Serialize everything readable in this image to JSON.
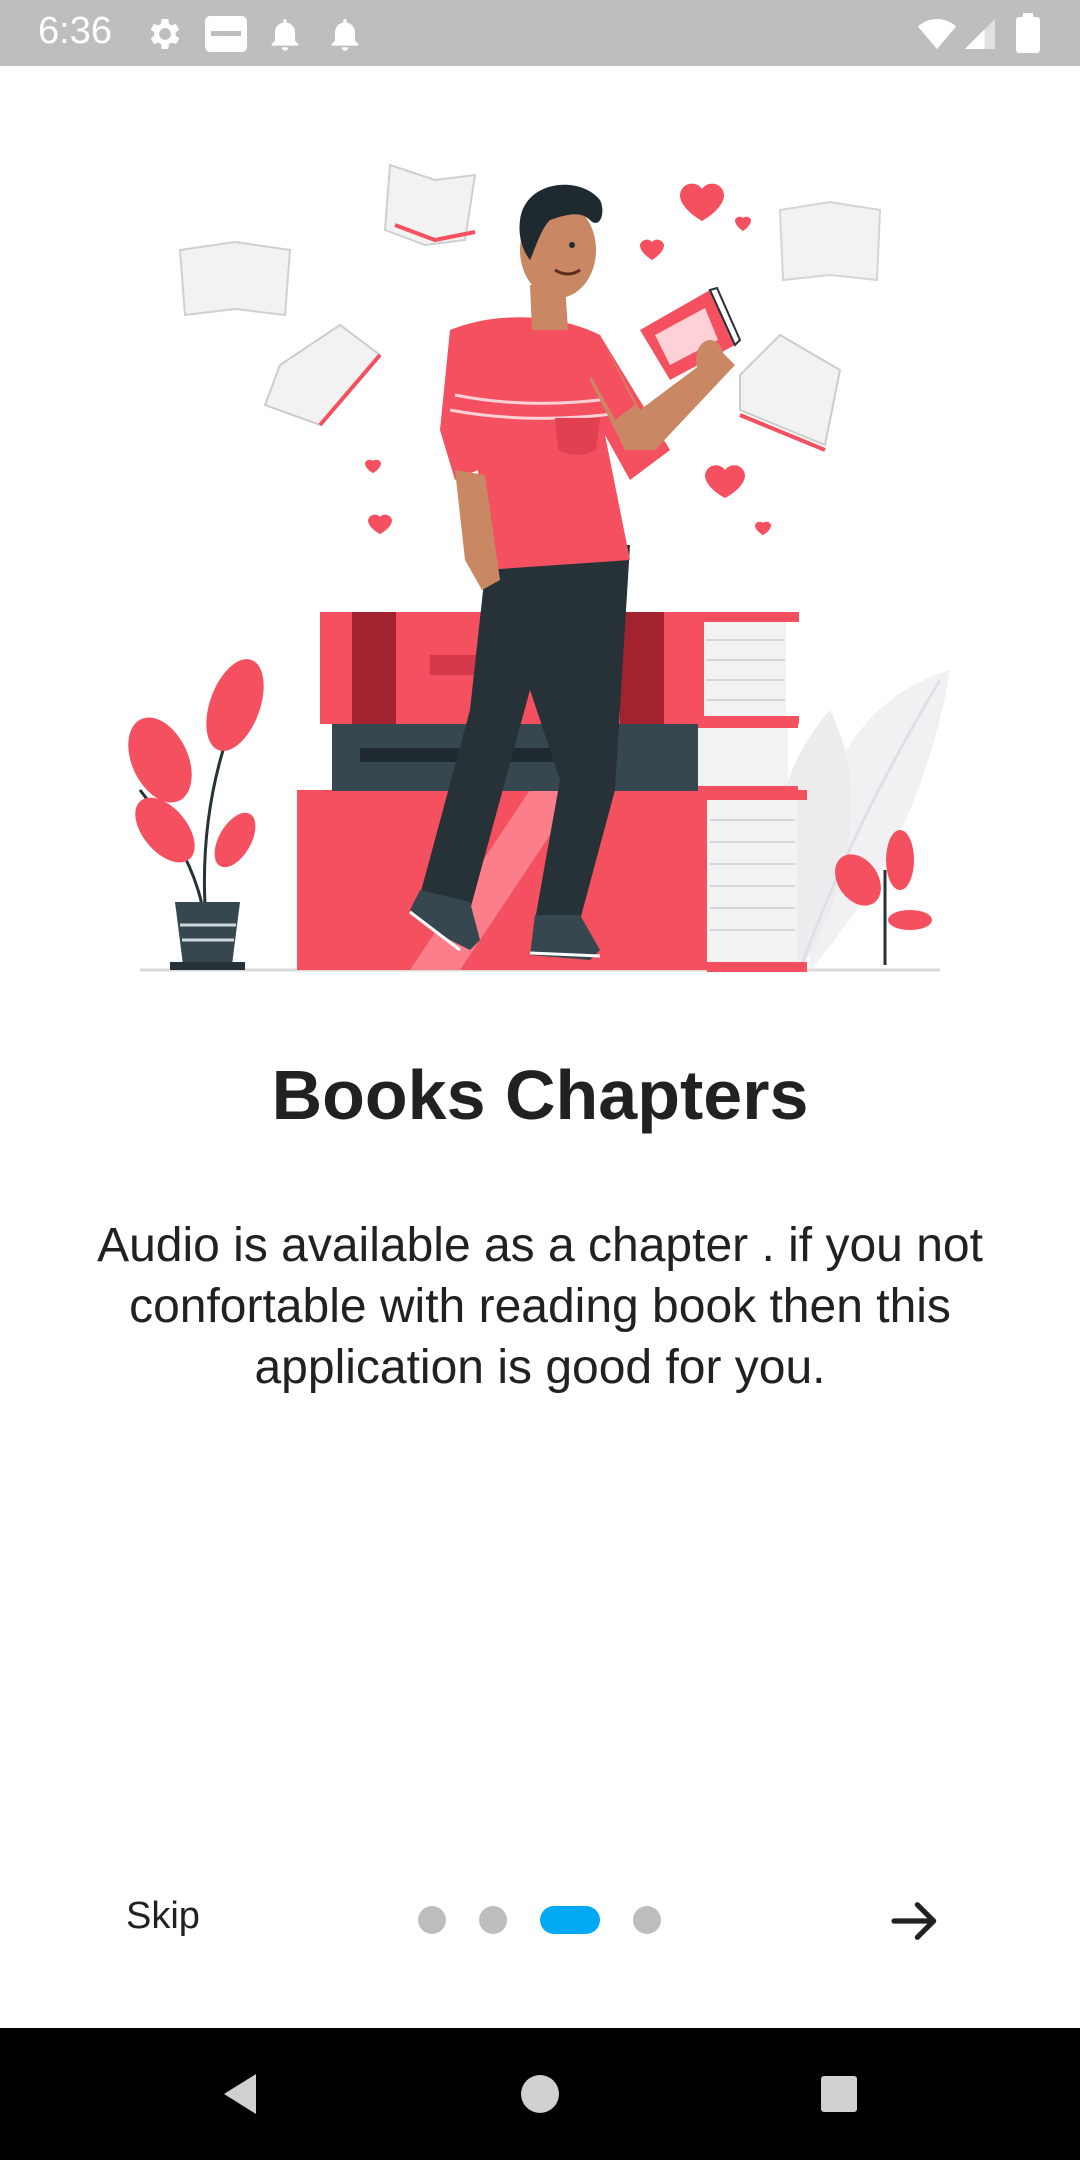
{
  "status_bar": {
    "time": "6:36",
    "icons": [
      "gear-icon",
      "app-notification-icon",
      "bell-icon",
      "bell-icon",
      "wifi-icon",
      "signal-icon",
      "battery-icon"
    ]
  },
  "onboarding": {
    "illustration": "person-reading-books-illustration",
    "title": "Books Chapters",
    "description": "Audio is available as a chapter . if you not confortable with reading book then this application is good for you.",
    "skip_label": "Skip",
    "page_count": 4,
    "current_page": 3,
    "next_icon": "arrow-right-icon",
    "accent_color": "#03a9f4",
    "illustration_color": "#f5505f"
  },
  "nav_bar": {
    "icons": [
      "back-icon",
      "home-icon",
      "recent-apps-icon"
    ]
  }
}
